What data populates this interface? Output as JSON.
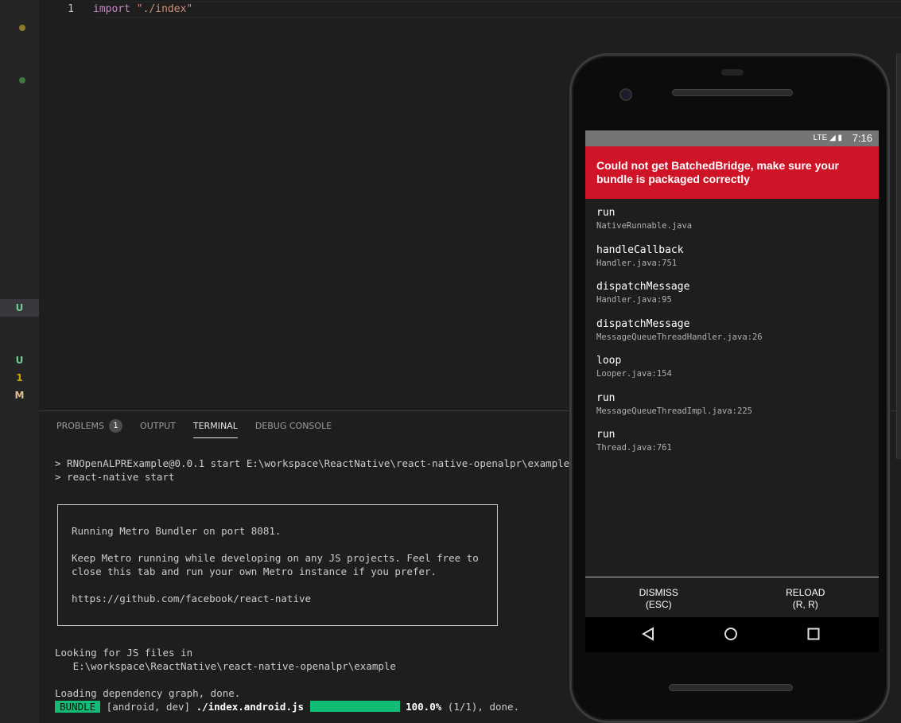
{
  "gutter": {
    "decorations": [
      {
        "type": "dot",
        "color": "#8a7a2a"
      },
      {
        "type": "dot",
        "color": "#3f7a3f"
      }
    ],
    "letters": [
      {
        "text": "U",
        "color": "#73c991"
      },
      {
        "text": "U",
        "color": "#73c991"
      },
      {
        "text": "1",
        "color": "#cca700"
      },
      {
        "text": "M",
        "color": "#e2c08d"
      }
    ]
  },
  "editor": {
    "line_number": "1",
    "keyword": "import",
    "string": "\"./index\""
  },
  "panel": {
    "tabs": [
      {
        "label": "PROBLEMS",
        "badge": "1"
      },
      {
        "label": "OUTPUT"
      },
      {
        "label": "TERMINAL",
        "active": true
      },
      {
        "label": "DEBUG CONSOLE"
      }
    ],
    "terminal": {
      "cmd1": "> RNOpenALPRExample@0.0.1 start E:\\workspace\\ReactNative\\react-native-openalpr\\example",
      "cmd2": "> react-native start",
      "box_line1": "Running Metro Bundler on port 8081.",
      "box_line2": "Keep Metro running while developing on any JS projects. Feel free to",
      "box_line3": "close this tab and run your own Metro instance if you prefer.",
      "box_line4": "https://github.com/facebook/react-native",
      "looking": "Looking for JS files in",
      "path": "   E:\\workspace\\ReactNative\\react-native-openalpr\\example",
      "loading": "Loading dependency graph, done.",
      "bundle_tag": "BUNDLE",
      "bundle_target": " [android, dev] ",
      "bundle_file": "./index.android.js",
      "bundle_progress": 1.0,
      "bundle_percent": "100.0%",
      "bundle_rest": " (1/1), done."
    }
  },
  "phone": {
    "status": {
      "time": "7:16",
      "signal": "LTE"
    },
    "error_title": "Could not get BatchedBridge, make sure your bundle is packaged correctly",
    "stack": [
      {
        "fn": "run",
        "file": "NativeRunnable.java"
      },
      {
        "fn": "handleCallback",
        "file": "Handler.java:751"
      },
      {
        "fn": "dispatchMessage",
        "file": "Handler.java:95"
      },
      {
        "fn": "dispatchMessage",
        "file": "MessageQueueThreadHandler.java:26"
      },
      {
        "fn": "loop",
        "file": "Looper.java:154"
      },
      {
        "fn": "run",
        "file": "MessageQueueThreadImpl.java:225"
      },
      {
        "fn": "run",
        "file": "Thread.java:761"
      }
    ],
    "actions": {
      "dismiss": "DISMISS",
      "dismiss_key": "(ESC)",
      "reload": "RELOAD",
      "reload_key": "(R, R)"
    }
  }
}
